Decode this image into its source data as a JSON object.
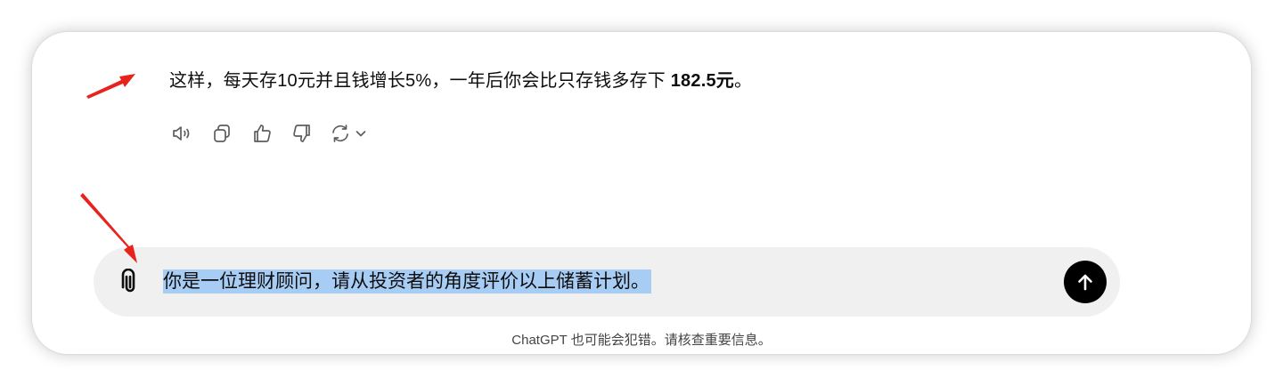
{
  "chat": {
    "assistant_message": {
      "text_before": "这样，每天存10元并且钱增长5%，一年后你会比只存钱多存下 ",
      "text_bold": "182.5元",
      "text_after": "。"
    },
    "actions": [
      {
        "icon": "speaker-icon",
        "label": "read-aloud"
      },
      {
        "icon": "copy-icon",
        "label": "copy"
      },
      {
        "icon": "thumbs-up-icon",
        "label": "good-response"
      },
      {
        "icon": "thumbs-down-icon",
        "label": "bad-response"
      },
      {
        "icon": "regenerate-icon",
        "label": "regenerate"
      }
    ]
  },
  "composer": {
    "input_value": "你是一位理财顾问，请从投资者的角度评价以上储蓄计划。",
    "attach_icon": "paperclip-icon",
    "send_icon": "arrow-up-icon"
  },
  "footer": {
    "disclaimer": "ChatGPT 也可能会犯错。请核查重要信息。"
  },
  "colors": {
    "selection": "#a8cdf5",
    "composer_bg": "#f0f0f0",
    "send_bg": "#000000",
    "annotation_arrow": "#e8231e"
  }
}
